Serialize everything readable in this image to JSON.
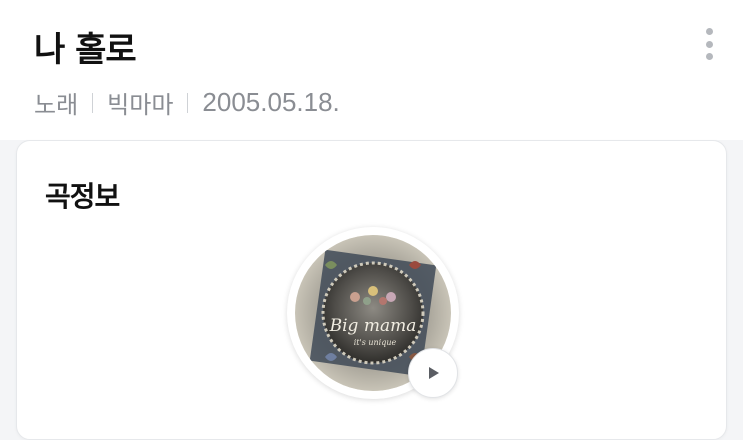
{
  "song": {
    "title": "나 홀로",
    "type": "노래",
    "artist": "빅마마",
    "date": "2005.05.18."
  },
  "card": {
    "title": "곡정보"
  },
  "album": {
    "cover_text": "Big mama",
    "cover_subtext": "it's unique"
  },
  "icons": {
    "menu": "more-vertical-icon",
    "play": "play-icon"
  },
  "colors": {
    "title": "#111111",
    "meta": "#8a8d93",
    "background": "#f4f5f7"
  }
}
